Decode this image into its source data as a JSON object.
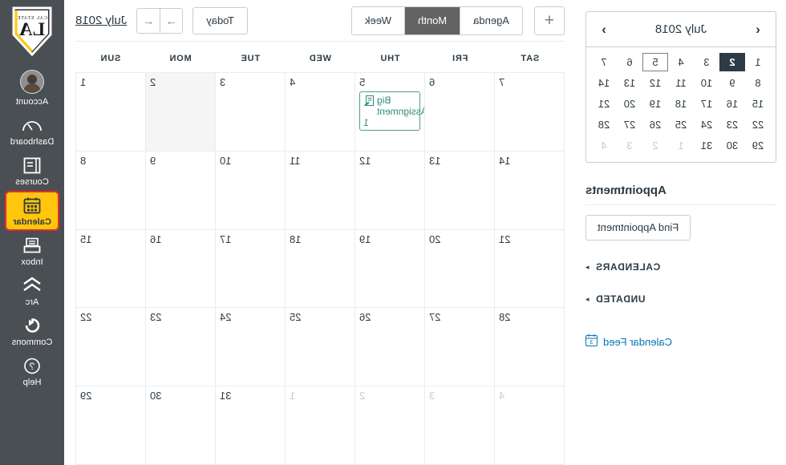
{
  "global_nav": {
    "logo": {
      "name": "cal-state-la-logo",
      "line1": "CAL STATE",
      "line2": "LA"
    },
    "items": [
      {
        "label": "Account",
        "icon": "avatar-icon",
        "active": false
      },
      {
        "label": "Dashboard",
        "icon": "dashboard-speedometer-icon",
        "active": false
      },
      {
        "label": "Courses",
        "icon": "courses-book-icon",
        "active": false
      },
      {
        "label": "Calendar",
        "icon": "calendar-icon",
        "active": true
      },
      {
        "label": "Inbox",
        "icon": "inbox-tray-icon",
        "active": false
      },
      {
        "label": "Arc",
        "icon": "arc-chevron-icon",
        "active": false
      },
      {
        "label": "Commons",
        "icon": "commons-arrow-icon",
        "active": false
      },
      {
        "label": "Help",
        "icon": "help-question-icon",
        "active": false
      }
    ],
    "highlight_color": "#ffc60b",
    "highlight_outline_color": "#e8292f",
    "background_color": "#4a4f53"
  },
  "sidepanel": {
    "mini_calendar": {
      "title": "July 2018",
      "prev_label": "‹",
      "next_label": "›",
      "weeks": [
        [
          {
            "d": "1",
            "state": "normal"
          },
          {
            "d": "2",
            "state": "selected"
          },
          {
            "d": "3",
            "state": "normal"
          },
          {
            "d": "4",
            "state": "normal"
          },
          {
            "d": "5",
            "state": "outlined"
          },
          {
            "d": "6",
            "state": "normal"
          },
          {
            "d": "7",
            "state": "normal"
          }
        ],
        [
          {
            "d": "8",
            "state": "normal"
          },
          {
            "d": "9",
            "state": "normal"
          },
          {
            "d": "10",
            "state": "normal"
          },
          {
            "d": "11",
            "state": "normal"
          },
          {
            "d": "12",
            "state": "normal"
          },
          {
            "d": "13",
            "state": "normal"
          },
          {
            "d": "14",
            "state": "normal"
          }
        ],
        [
          {
            "d": "15",
            "state": "normal"
          },
          {
            "d": "16",
            "state": "normal"
          },
          {
            "d": "17",
            "state": "normal"
          },
          {
            "d": "18",
            "state": "normal"
          },
          {
            "d": "19",
            "state": "normal"
          },
          {
            "d": "20",
            "state": "normal"
          },
          {
            "d": "21",
            "state": "normal"
          }
        ],
        [
          {
            "d": "22",
            "state": "normal"
          },
          {
            "d": "23",
            "state": "normal"
          },
          {
            "d": "24",
            "state": "normal"
          },
          {
            "d": "25",
            "state": "normal"
          },
          {
            "d": "26",
            "state": "normal"
          },
          {
            "d": "27",
            "state": "normal"
          },
          {
            "d": "28",
            "state": "normal"
          }
        ],
        [
          {
            "d": "29",
            "state": "normal"
          },
          {
            "d": "30",
            "state": "normal"
          },
          {
            "d": "31",
            "state": "normal"
          },
          {
            "d": "1",
            "state": "other"
          },
          {
            "d": "2",
            "state": "other"
          },
          {
            "d": "3",
            "state": "other"
          },
          {
            "d": "4",
            "state": "other"
          }
        ]
      ]
    },
    "appointments_heading": "Appointments",
    "find_appointment_label": "Find Appointment",
    "sections": [
      {
        "label": "CALENDARS",
        "arrow": "▸"
      },
      {
        "label": "UNDATED",
        "arrow": "▸"
      }
    ],
    "calendar_feed_label": "Calendar Feed",
    "calendar_feed_icon": "calendar-feed-icon"
  },
  "toolbar": {
    "add_label": "+",
    "views": [
      {
        "label": "Week",
        "active": false
      },
      {
        "label": "Month",
        "active": true
      },
      {
        "label": "Agenda",
        "active": false
      }
    ],
    "month_link": "July 2018",
    "prev_arrow": "←",
    "next_arrow": "→",
    "today_label": "Today"
  },
  "calendar": {
    "weekday_headers": [
      "SUN",
      "MON",
      "TUE",
      "WED",
      "THU",
      "FRI",
      "SAT"
    ],
    "event_accent_color": "#2d8a7a",
    "today_cell_color": "#f5f5f5",
    "weeks": [
      [
        {
          "d": "1",
          "other": false,
          "today": false,
          "events": []
        },
        {
          "d": "2",
          "other": false,
          "today": true,
          "events": []
        },
        {
          "d": "3",
          "other": false,
          "today": false,
          "events": []
        },
        {
          "d": "4",
          "other": false,
          "today": false,
          "events": []
        },
        {
          "d": "5",
          "other": false,
          "today": false,
          "events": [
            {
              "title": "Big Assignment",
              "time": "1",
              "icon": "assignment-icon"
            }
          ]
        },
        {
          "d": "6",
          "other": false,
          "today": false,
          "events": []
        },
        {
          "d": "7",
          "other": false,
          "today": false,
          "events": []
        }
      ],
      [
        {
          "d": "8",
          "other": false,
          "today": false,
          "events": []
        },
        {
          "d": "9",
          "other": false,
          "today": false,
          "events": []
        },
        {
          "d": "10",
          "other": false,
          "today": false,
          "events": []
        },
        {
          "d": "11",
          "other": false,
          "today": false,
          "events": []
        },
        {
          "d": "12",
          "other": false,
          "today": false,
          "events": []
        },
        {
          "d": "13",
          "other": false,
          "today": false,
          "events": []
        },
        {
          "d": "14",
          "other": false,
          "today": false,
          "events": []
        }
      ],
      [
        {
          "d": "15",
          "other": false,
          "today": false,
          "events": []
        },
        {
          "d": "16",
          "other": false,
          "today": false,
          "events": []
        },
        {
          "d": "17",
          "other": false,
          "today": false,
          "events": []
        },
        {
          "d": "18",
          "other": false,
          "today": false,
          "events": []
        },
        {
          "d": "19",
          "other": false,
          "today": false,
          "events": []
        },
        {
          "d": "20",
          "other": false,
          "today": false,
          "events": []
        },
        {
          "d": "21",
          "other": false,
          "today": false,
          "events": []
        }
      ],
      [
        {
          "d": "22",
          "other": false,
          "today": false,
          "events": []
        },
        {
          "d": "23",
          "other": false,
          "today": false,
          "events": []
        },
        {
          "d": "24",
          "other": false,
          "today": false,
          "events": []
        },
        {
          "d": "25",
          "other": false,
          "today": false,
          "events": []
        },
        {
          "d": "26",
          "other": false,
          "today": false,
          "events": []
        },
        {
          "d": "27",
          "other": false,
          "today": false,
          "events": []
        },
        {
          "d": "28",
          "other": false,
          "today": false,
          "events": []
        }
      ],
      [
        {
          "d": "29",
          "other": false,
          "today": false,
          "events": []
        },
        {
          "d": "30",
          "other": false,
          "today": false,
          "events": []
        },
        {
          "d": "31",
          "other": false,
          "today": false,
          "events": []
        },
        {
          "d": "1",
          "other": true,
          "today": false,
          "events": []
        },
        {
          "d": "2",
          "other": true,
          "today": false,
          "events": []
        },
        {
          "d": "3",
          "other": true,
          "today": false,
          "events": []
        },
        {
          "d": "4",
          "other": true,
          "today": false,
          "events": []
        }
      ]
    ]
  }
}
